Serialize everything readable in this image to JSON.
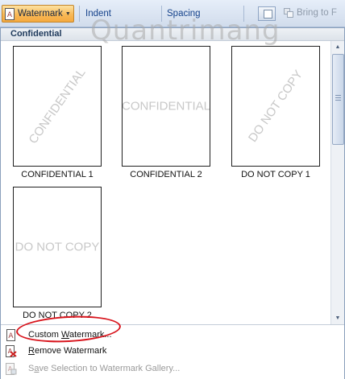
{
  "ribbon": {
    "watermark_button": "Watermark",
    "indent_label": "Indent",
    "spacing_label": "Spacing",
    "bring_to_front_label": "Bring to F"
  },
  "overlay": {
    "site_watermark": "Quantrimang"
  },
  "gallery": {
    "section_title": "Confidential",
    "items": [
      {
        "preview": "CONFIDENTIAL",
        "style": "diagonal",
        "caption": "CONFIDENTIAL 1"
      },
      {
        "preview": "CONFIDENTIAL",
        "style": "horizontal",
        "caption": "CONFIDENTIAL 2"
      },
      {
        "preview": "DO NOT COPY",
        "style": "diagonal",
        "caption": "DO NOT COPY 1"
      },
      {
        "preview": "DO NOT COPY",
        "style": "horizontal",
        "caption": "DO NOT COPY 2"
      }
    ]
  },
  "menu": {
    "custom_watermark": {
      "before": "Custom ",
      "key": "W",
      "after": "atermark..."
    },
    "remove_watermark": {
      "key": "R",
      "after": "emove Watermark"
    },
    "save_selection": {
      "before": "S",
      "key": "a",
      "after": "ve Selection to Watermark Gallery..."
    }
  },
  "colors": {
    "ribbon_bg": "#d9e4f3",
    "active_button": "#f8b957",
    "highlight_ring": "#d8141c"
  }
}
